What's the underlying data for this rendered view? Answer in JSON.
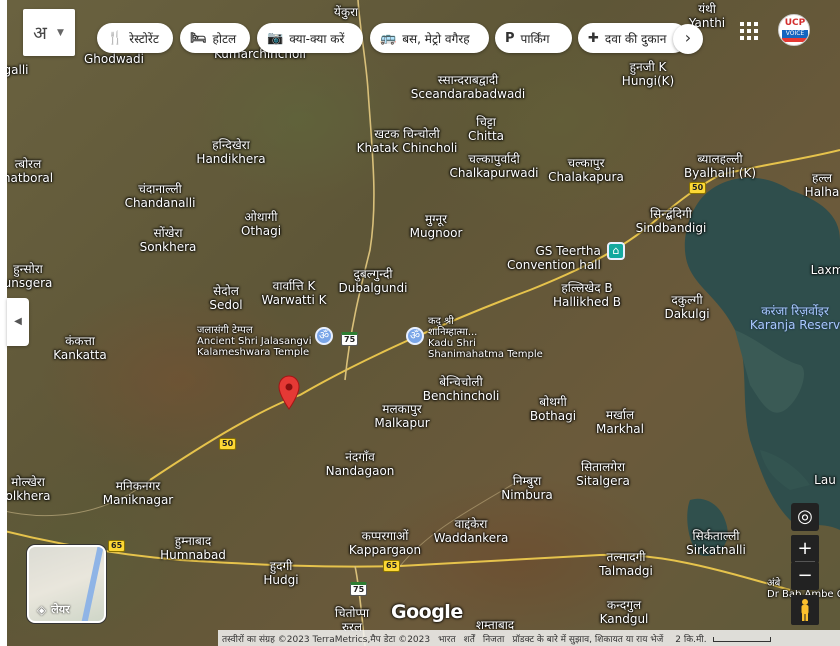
{
  "top_bar": {
    "language_char": "अ",
    "chips": [
      {
        "icon": "restaurant-icon",
        "glyph": "🍴",
        "label": "रेस्टोरेंट"
      },
      {
        "icon": "hotel-icon",
        "glyph": "🛏",
        "label": "होटल"
      },
      {
        "icon": "camera-icon",
        "glyph": "📷",
        "label": "क्या-क्या करें"
      },
      {
        "icon": "bus-icon",
        "glyph": "🚌",
        "label": "बस, मेट्रो वगैरह"
      },
      {
        "icon": "parking-icon",
        "glyph": "P",
        "label": "पार्किंग"
      },
      {
        "icon": "pharmacy-icon",
        "glyph": "✚",
        "label": "दवा की दुकान"
      }
    ],
    "next_glyph": "›",
    "avatar_text": "UCP",
    "avatar_sub": "VOICE"
  },
  "places": [
    {
      "hi": "येंकुरा",
      "en": ""
    },
    {
      "hi": "",
      "en": "Ghodwadi"
    },
    {
      "hi": "",
      "en": "Kumarchincholi"
    },
    {
      "hi": "यंथी",
      "en": "Yanthi"
    },
    {
      "hi": "",
      "en": "galli"
    },
    {
      "hi": "स्सान्दराबद्वादी",
      "en": "Sceandarabadwadi"
    },
    {
      "hi": "हुनजी K",
      "en": "Hungi(K)"
    },
    {
      "hi": "हन्दिखेरा",
      "en": "Handikhera"
    },
    {
      "hi": "खटक चिन्चोली",
      "en": "Khatak Chincholi"
    },
    {
      "hi": "चिट्टा",
      "en": "Chitta"
    },
    {
      "hi": "चल्कापुर्वादी",
      "en": "Chalkapurwadi"
    },
    {
      "hi": "चल्कापुर",
      "en": "Chalakapura"
    },
    {
      "hi": "ब्यालहल्ली",
      "en": "Byalhalli (K)"
    },
    {
      "hi": "हल्ल",
      "en": "Halha"
    },
    {
      "hi": "त्बोरल",
      "en": "hatboral"
    },
    {
      "hi": "चंदानाल्ली",
      "en": "Chandanalli"
    },
    {
      "hi": "ओथागी",
      "en": "Othagi"
    },
    {
      "hi": "मुग्नूर",
      "en": "Mugnoor"
    },
    {
      "hi": "सिन्द्बंदिगी",
      "en": "Sindbandigi"
    },
    {
      "hi": "सोंखेरा",
      "en": "Sonkhera"
    },
    {
      "hi": "हुन्सोरा",
      "en": "unsgera"
    },
    {
      "hi": "सेदोल",
      "en": "Sedol"
    },
    {
      "hi": "वार्वात्ति K",
      "en": "Warwatti K"
    },
    {
      "hi": "दुबल्गुन्दी",
      "en": "Dubalgundi"
    },
    {
      "hi": "हल्लिखेद B",
      "en": "Hallikhed B"
    },
    {
      "hi": "दकुल्गी",
      "en": "Dakulgi"
    },
    {
      "hi": "कंकत्ता",
      "en": "Kankatta"
    },
    {
      "hi": "बेन्चिचोली",
      "en": "Benchincholi"
    },
    {
      "hi": "मलकापुर",
      "en": "Malkapur"
    },
    {
      "hi": "बोथगी",
      "en": "Bothagi"
    },
    {
      "hi": "मर्खाल",
      "en": "Markhal"
    },
    {
      "hi": "नंदगाँव",
      "en": "Nandagaon"
    },
    {
      "hi": "मोल्खेरा",
      "en": "olkhera"
    },
    {
      "hi": "मनिकनगर",
      "en": "Maniknagar"
    },
    {
      "hi": "निम्बुरा",
      "en": "Nimbura"
    },
    {
      "hi": "सितालगेरा",
      "en": "Sitalgera"
    },
    {
      "hi": "हुम्नाबाद",
      "en": "Humnabad"
    },
    {
      "hi": "कप्परगाओं",
      "en": "Kappargaon"
    },
    {
      "hi": "वाद्दंकेरा",
      "en": "Waddankera"
    },
    {
      "hi": "सिर्कताल्ली",
      "en": "Sirkatnalli"
    },
    {
      "hi": "हुदगी",
      "en": "Hudgi"
    },
    {
      "hi": "तल्मादगी",
      "en": "Talmadgi"
    },
    {
      "hi": "कन्दगुल",
      "en": "Kandgul"
    },
    {
      "hi": "चितोप्पा",
      "en": "रुरल"
    },
    {
      "hi": "शम्ताबाद",
      "en": ""
    },
    {
      "hi": "",
      "en": "Laxm"
    },
    {
      "hi": "",
      "en": "Lau"
    },
    {
      "hi": "अंबे",
      "en": "Dr Bab Ambe Circl"
    }
  ],
  "water": {
    "hi": "करंजा रिज़र्वोइर",
    "en": "Karanja Reserv"
  },
  "pois": [
    {
      "hi": "GS Teertha",
      "en": "Convention hall"
    },
    {
      "hi": "जलासंगी टेम्पल",
      "en": "Ancient Shri Jalasangvi",
      "en2": "Kalameshwara Temple"
    },
    {
      "hi": "कदु श्री",
      "en": "शानिम्हात्मा...",
      "en2": "Kadu Shri",
      "en3": "Shanimahatma Temple"
    }
  ],
  "shields": [
    "75",
    "50",
    "65",
    "65",
    "75",
    "50"
  ],
  "controls": {
    "side_toggle": "◀",
    "layers_label": "लेयर",
    "zoom_in": "+",
    "zoom_out": "−",
    "locate_glyph": "◎"
  },
  "google_logo": "Google",
  "footer": {
    "imagery": "तस्वीरों का संग्रह ©2023 TerraMetrics,मैप डेटा ©2023",
    "links": [
      "भारत",
      "शर्तें",
      "निजता",
      "प्रॉडक्ट के बारे में सुझाव, शिकायत या राय भेजें"
    ],
    "scale": "2 कि.मी."
  },
  "colors": {
    "chip_bg": "#ffffff",
    "pin": "#e53935",
    "water_label": "#aac8ff"
  }
}
